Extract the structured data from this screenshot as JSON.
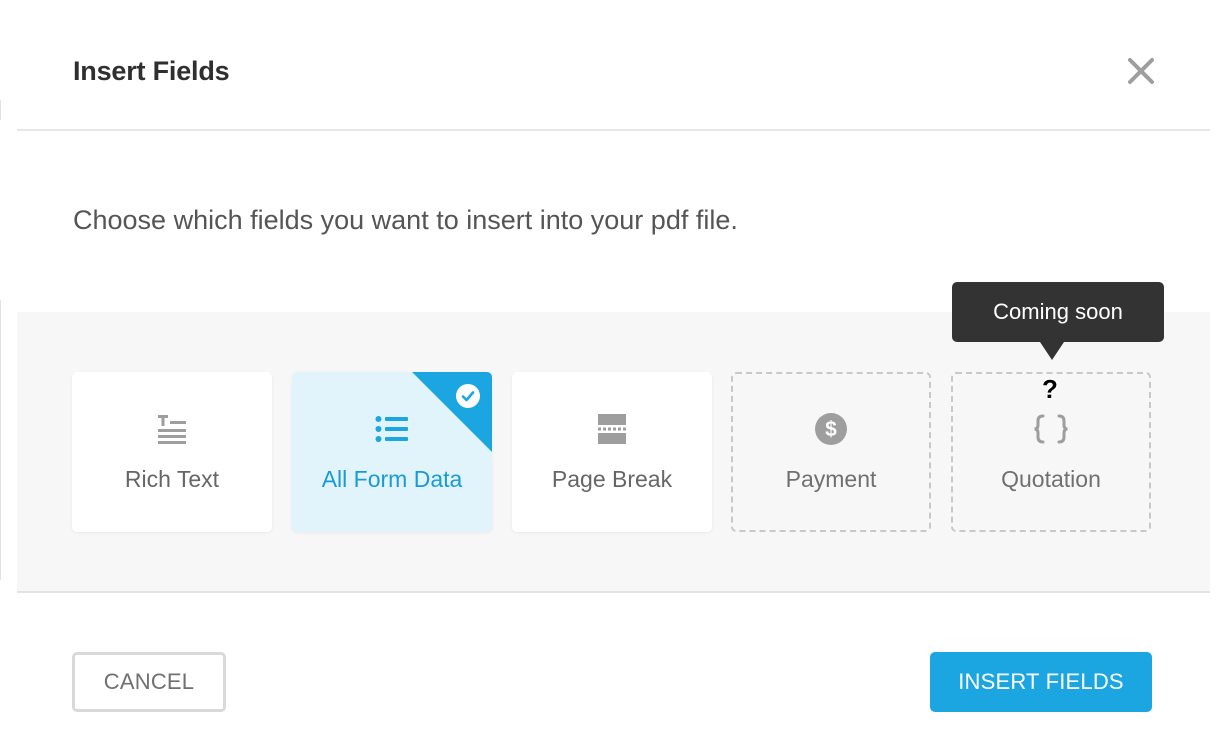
{
  "dialog": {
    "title": "Insert Fields",
    "description": "Choose which fields you want to insert into your pdf file."
  },
  "fields": [
    {
      "label": "Rich Text",
      "icon": "rich-text-icon",
      "state": "available"
    },
    {
      "label": "All Form Data",
      "icon": "list-icon",
      "state": "selected"
    },
    {
      "label": "Page Break",
      "icon": "page-break-icon",
      "state": "available"
    },
    {
      "label": "Payment",
      "icon": "dollar-icon",
      "state": "disabled"
    },
    {
      "label": "Quotation",
      "icon": "braces-icon",
      "state": "disabled"
    }
  ],
  "tooltip": {
    "text": "Coming soon",
    "cursor_glyph": "?"
  },
  "footer": {
    "cancel_label": "CANCEL",
    "insert_label": "INSERT FIELDS"
  },
  "colors": {
    "accent": "#1ba6e2",
    "selected_bg": "#e1f4fc",
    "selected_text": "#1a9ad6",
    "tooltip_bg": "#333333",
    "icon_gray": "#9e9e9e"
  }
}
